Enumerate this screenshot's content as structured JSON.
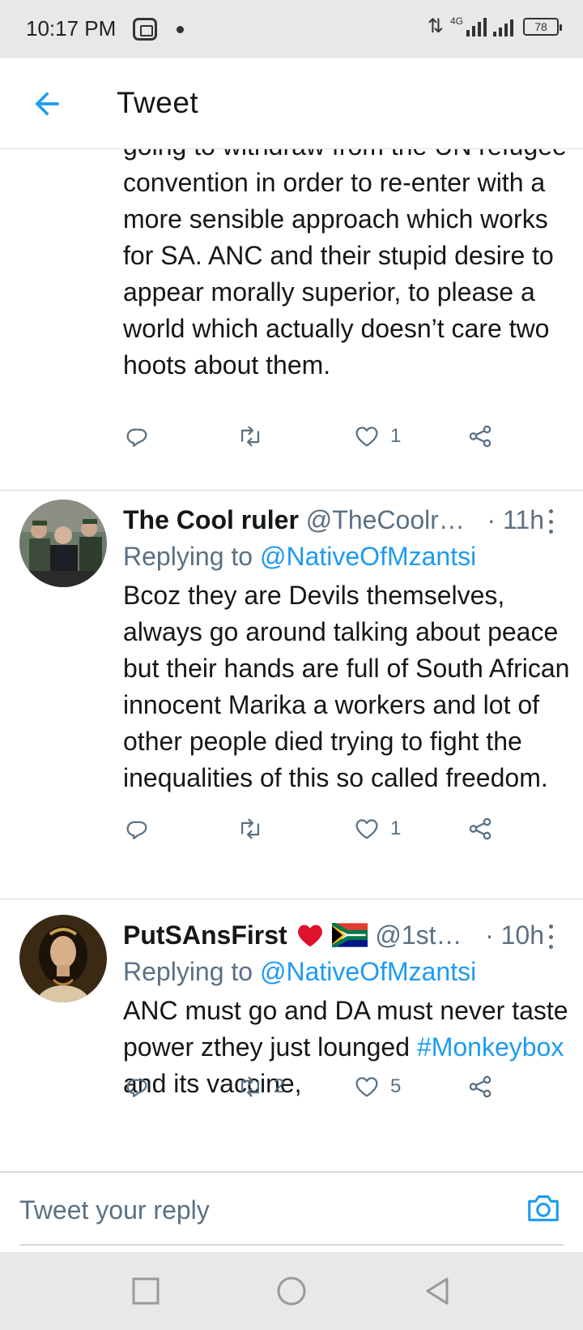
{
  "status_bar": {
    "time": "10:17 PM",
    "network_type": "4G",
    "battery": "78",
    "icons": [
      "app-notification-icon",
      "data-arrows-icon",
      "signal-icon",
      "battery-icon"
    ]
  },
  "header": {
    "title": "Tweet",
    "back_icon": "arrow-left-icon"
  },
  "tweets": [
    {
      "body": "going to withdraw from the UN refugee convention in order to re-enter with a more sensible approach which works for SA. ANC and their stupid desire to appear morally superior, to please a world which actually doesn’t care two hoots about them.",
      "replies": "",
      "retweets": "",
      "likes": "1"
    },
    {
      "display_name": "The Cool ruler",
      "handle": "@TheCoolr…",
      "time": "· 11h",
      "replying_label": "Replying to",
      "replying_to": "@NativeOfMzantsi",
      "body": "Bcoz they are Devils themselves, always go around talking about peace but their hands are full of South African innocent Marika a workers and lot of other people died trying to fight the inequalities of this so called freedom.",
      "replies": "",
      "retweets": "",
      "likes": "1"
    },
    {
      "display_name": "PutSAnsFirst",
      "handle": "@1st…",
      "time": "· 10h",
      "replying_label": "Replying to",
      "replying_to": "@NativeOfMzantsi",
      "body_before": "ANC must go and DA must never taste power zthey just lounged ",
      "hashtag": "#Monkeybox",
      "body_after": " and its vaccine,",
      "replies": "",
      "retweets": "2",
      "likes": "5"
    }
  ],
  "reply_bar": {
    "placeholder": "Tweet your reply",
    "camera_icon": "camera-icon"
  },
  "nav_bar": {
    "icons": [
      "square-recents-icon",
      "circle-home-icon",
      "triangle-back-icon"
    ]
  },
  "colors": {
    "accent": "#1d9bf0",
    "secondary_text": "#5b7083",
    "primary_text": "#14171a",
    "heart": "#e0112b"
  }
}
